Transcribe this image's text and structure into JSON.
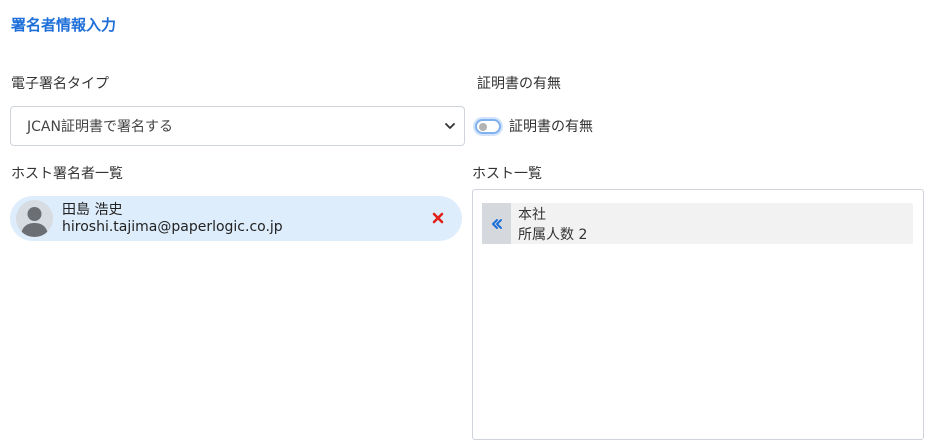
{
  "section": {
    "title": "署名者情報入力"
  },
  "signature_type": {
    "label": "電子署名タイプ",
    "selected": "JCAN証明書で署名する"
  },
  "certificate": {
    "label": "証明書の有無",
    "toggle_label": "証明書の有無",
    "enabled": false
  },
  "host_signers": {
    "label": "ホスト署名者一覧",
    "items": [
      {
        "name": "田島 浩史",
        "email": "hiroshi.tajima@paperlogic.co.jp"
      }
    ]
  },
  "hosts": {
    "label": "ホスト一覧",
    "items": [
      {
        "name": "本社",
        "member_count": "所属人数 2"
      }
    ]
  },
  "colors": {
    "accent": "#1e6fd9",
    "chip_bg": "#deedfc",
    "remove": "#e0211b"
  },
  "icons": {
    "select_arrow": "chevron-down-icon",
    "avatar": "user-avatar-icon",
    "remove": "close-icon",
    "add": "double-chevron-left-icon"
  }
}
